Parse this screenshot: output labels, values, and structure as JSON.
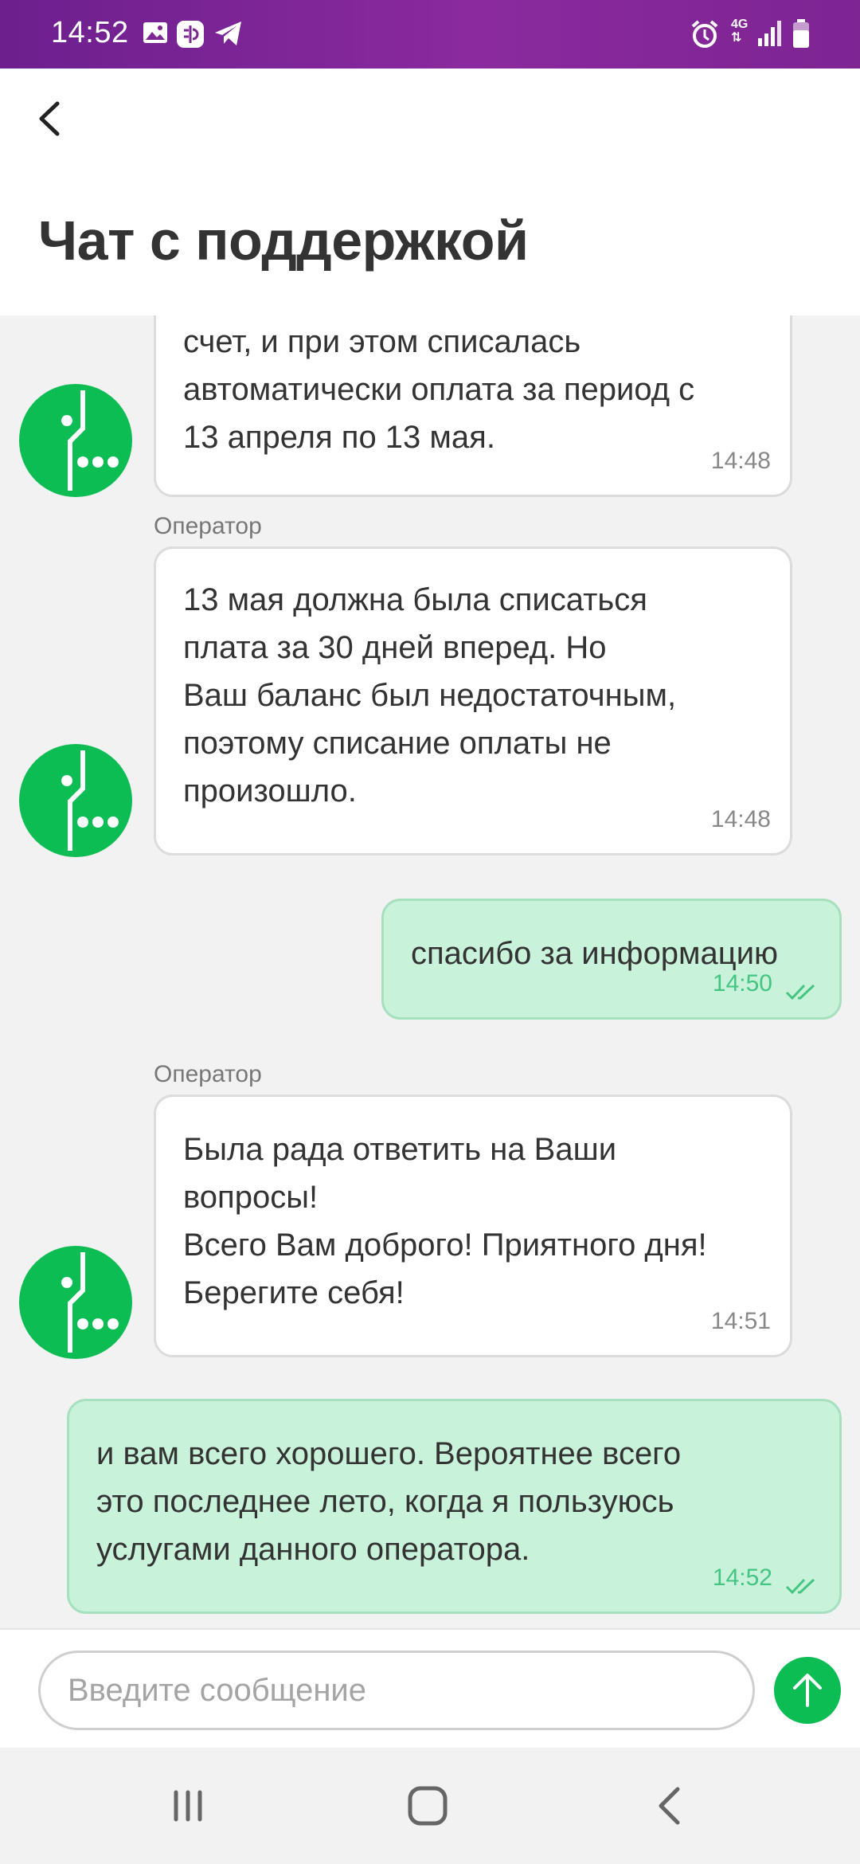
{
  "status_bar": {
    "time": "14:52",
    "network": "4G",
    "icons": [
      "image-icon",
      "messenger-app-icon",
      "telegram-icon",
      "alarm-icon",
      "network-4g-icon",
      "signal-icon",
      "battery-icon"
    ]
  },
  "header": {
    "title": "Чат с поддержкой",
    "back_icon": "back-arrow-icon"
  },
  "messages": [
    {
      "from": "operator",
      "sender": "",
      "text": "счет, и при этом списалась\nавтоматически оплата за период с\n13 апреля по 13 мая.",
      "time": "14:48"
    },
    {
      "from": "operator",
      "sender": "Оператор",
      "text": "13 мая должна была списаться\nплата за 30 дней вперед. Но\nВаш баланс был недостаточным,\nпоэтому списание оплаты не\nпроизошло.",
      "time": "14:48"
    },
    {
      "from": "user",
      "text": "спасибо за информацию",
      "time": "14:50",
      "status": "read"
    },
    {
      "from": "operator",
      "sender": "Оператор",
      "text": "Была рада ответить на Ваши\nвопросы!\nВсего Вам доброго! Приятного дня!\nБерегите себя!",
      "time": "14:51"
    },
    {
      "from": "user",
      "text": "и вам всего хорошего. Вероятнее всего\nэто последнее лето, когда я пользуюсь\nуслугами данного оператора.",
      "time": "14:52",
      "status": "read"
    }
  ],
  "input": {
    "placeholder": "Введите сообщение",
    "value": ""
  },
  "colors": {
    "status_bar": "#7e2493",
    "brand_green": "#0bbd52",
    "user_bubble": "#c8f2da",
    "user_time": "#45c582",
    "operator_bubble": "#ffffff"
  },
  "navigation": [
    "recent-apps-icon",
    "home-icon",
    "back-icon"
  ]
}
